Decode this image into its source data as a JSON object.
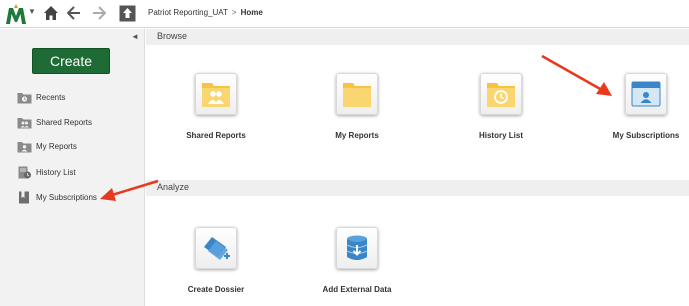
{
  "topbar": {
    "project": "Patriot Reporting_UAT",
    "separator": ">",
    "current": "Home"
  },
  "sidebar": {
    "create_label": "Create",
    "items": [
      {
        "label": "Recents",
        "icon": "recents-folder-icon"
      },
      {
        "label": "Shared Reports",
        "icon": "shared-reports-folder-icon"
      },
      {
        "label": "My Reports",
        "icon": "my-reports-folder-icon"
      },
      {
        "label": "History List",
        "icon": "history-list-icon"
      },
      {
        "label": "My Subscriptions",
        "icon": "subscriptions-bookmark-icon"
      }
    ]
  },
  "main": {
    "browse_heading": "Browse",
    "analyze_heading": "Analyze",
    "browse_tiles": [
      {
        "label": "Shared Reports",
        "icon": "shared-folder-icon"
      },
      {
        "label": "My Reports",
        "icon": "folder-icon"
      },
      {
        "label": "History List",
        "icon": "clock-folder-icon"
      },
      {
        "label": "My Subscriptions",
        "icon": "subscription-window-icon"
      }
    ],
    "analyze_tiles": [
      {
        "label": "Create Dossier",
        "icon": "dossier-icon"
      },
      {
        "label": "Add External Data",
        "icon": "database-icon"
      }
    ]
  },
  "colors": {
    "create_button": "#1e6b35",
    "folder_yellow": "#f6c445",
    "accent_blue": "#3a86c8",
    "annotation_arrow": "#e8381e",
    "logo_green": "#1d7a3a",
    "logo_gold": "#d4a017"
  }
}
